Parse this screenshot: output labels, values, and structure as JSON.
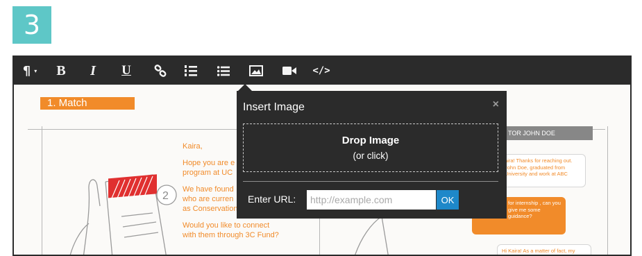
{
  "step_number": "3",
  "toolbar": {
    "icons": [
      "paragraph-dropdown-icon",
      "bold-icon",
      "italic-icon",
      "underline-icon",
      "link-icon",
      "ordered-list-icon",
      "unordered-list-icon",
      "image-icon",
      "video-icon",
      "code-icon"
    ],
    "paragraph": "¶",
    "bold": "B",
    "italic": "I",
    "underline": "U",
    "code": "</>"
  },
  "background": {
    "match_tab": "1.   Match",
    "sketch_number": "2",
    "letter": [
      "Kaira,",
      "Hope you are e",
      "program at UC",
      "We have found",
      "who are curren",
      "as Conservation Consultants.",
      "Would you like to connect",
      "with them through 3C Fund?"
    ],
    "mentor_header": "TOR JOHN DOE",
    "bubble1": "aira! Thanks for reaching out. John Doe, graduated from University and work at ABC",
    "bubble2": "for internship , can you give me some guidance?",
    "bubble3": "Hi Kaira! As a matter of fact, my"
  },
  "popup": {
    "title": "Insert Image",
    "close": "×",
    "drop_title": "Drop Image",
    "drop_sub": "(or click)",
    "url_label": "Enter URL:",
    "url_placeholder": "http://example.com",
    "url_value": "",
    "ok_label": "OK"
  },
  "colors": {
    "step_badge": "#5ec7c7",
    "toolbar": "#2b2b2b",
    "accent_orange": "#f18b2a",
    "ok_button": "#1e88c9"
  }
}
